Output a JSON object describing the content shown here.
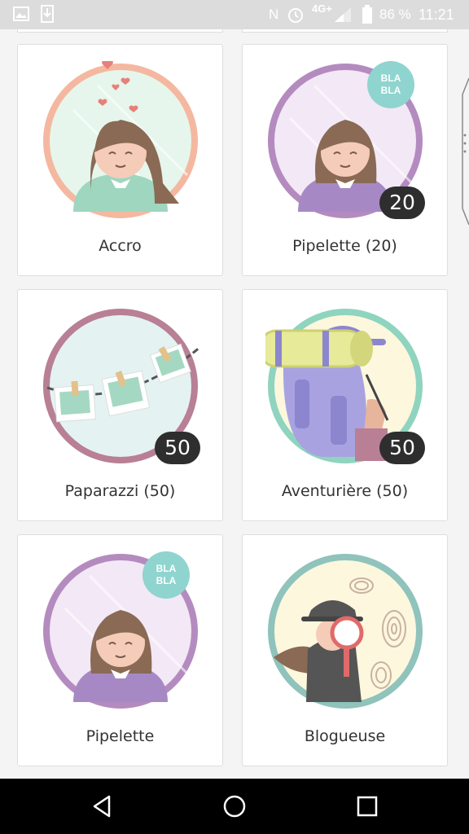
{
  "status_bar": {
    "network": "4G+",
    "battery": "86 %",
    "time": "11:21",
    "icons": [
      "image-icon",
      "download-icon",
      "nfc-icon",
      "alarm-icon",
      "signal-icon",
      "battery-icon"
    ]
  },
  "badges": [
    {
      "label": "Accro",
      "count": null,
      "bubble": null,
      "ring": "#f4b8a0"
    },
    {
      "label": "Pipelette (20)",
      "count": "20",
      "bubble": [
        "BLA",
        "BLA"
      ],
      "ring": "#b48bbf"
    },
    {
      "label": "Paparazzi (50)",
      "count": "50",
      "bubble": null,
      "ring": "#b87f95"
    },
    {
      "label": "Aventurière (50)",
      "count": "50",
      "bubble": null,
      "ring": "#8fd4bf"
    },
    {
      "label": "Pipelette",
      "count": null,
      "bubble": [
        "BLA",
        "BLA"
      ],
      "ring": "#b48bbf"
    },
    {
      "label": "Blogueuse",
      "count": null,
      "bubble": null,
      "ring": "#8fc3bc"
    }
  ],
  "nav": {
    "icons": [
      "back-icon",
      "home-icon",
      "recents-icon"
    ]
  }
}
